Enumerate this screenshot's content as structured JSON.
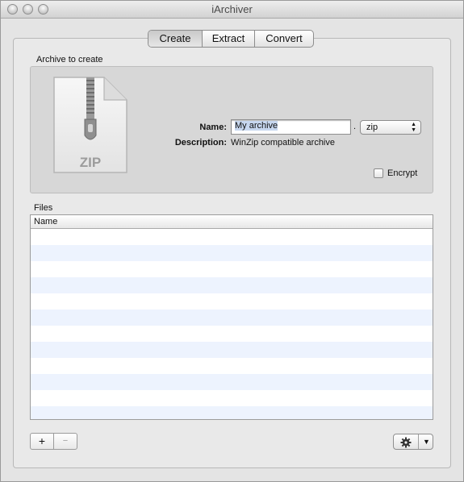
{
  "window": {
    "title": "iArchiver"
  },
  "tabs": [
    {
      "label": "Create",
      "selected": true
    },
    {
      "label": "Extract",
      "selected": false
    },
    {
      "label": "Convert",
      "selected": false
    }
  ],
  "archive_section": {
    "title": "Archive to create",
    "icon": {
      "name": "zip-file-icon",
      "text": "ZIP"
    },
    "name_label": "Name:",
    "name_value": "My archive",
    "separator": ".",
    "format_value": "zip",
    "description_label": "Description:",
    "description_value": "WinZip compatible archive",
    "encrypt_label": "Encrypt",
    "encrypt_checked": false
  },
  "files_section": {
    "title": "Files",
    "columns": [
      "Name"
    ],
    "rows": []
  },
  "toolbar": {
    "add_label": "+",
    "remove_label": "−",
    "action_icon": "gear-icon",
    "action_menu_icon": "triangle-down-icon"
  }
}
